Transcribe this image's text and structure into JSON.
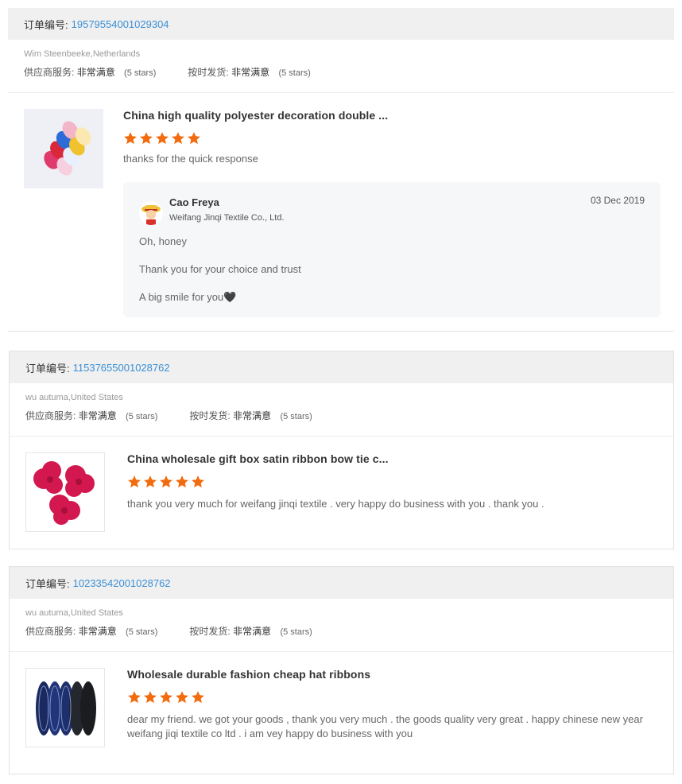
{
  "labels": {
    "order_no": "订单编号:",
    "supplier_service": "供应商服务:",
    "on_time_delivery": "按时发货:"
  },
  "reviews": [
    {
      "order_number": "19579554001029304",
      "buyer": "Wim Steenbeeke,Netherlands",
      "supplier_service": {
        "value": "非常满意",
        "stars_text": "(5 stars)"
      },
      "on_time_delivery": {
        "value": "非常满意",
        "stars_text": "(5 stars)"
      },
      "product_title": "China high quality polyester decoration double ...",
      "rating": 5,
      "comment": "thanks for the quick response",
      "reply": {
        "seller_name": "Cao Freya",
        "company": "Weifang Jinqi Textile Co., Ltd.",
        "date": "03 Dec 2019",
        "lines": [
          "Oh, honey",
          "Thank you for your choice and trust",
          "A big smile for you🖤"
        ]
      }
    },
    {
      "order_number": "11537655001028762",
      "buyer": "wu autuma,United States",
      "supplier_service": {
        "value": "非常满意",
        "stars_text": "(5 stars)"
      },
      "on_time_delivery": {
        "value": "非常满意",
        "stars_text": "(5 stars)"
      },
      "product_title": "China wholesale gift box satin ribbon bow tie c...",
      "rating": 5,
      "comment": "thank you very much for weifang jinqi textile . very happy do business with you . thank you ."
    },
    {
      "order_number": "10233542001028762",
      "buyer": "wu autuma,United States",
      "supplier_service": {
        "value": "非常满意",
        "stars_text": "(5 stars)"
      },
      "on_time_delivery": {
        "value": "非常满意",
        "stars_text": "(5 stars)"
      },
      "product_title": "Wholesale durable fashion cheap hat ribbons",
      "rating": 5,
      "comment": "dear my friend. we got your goods , thank you very much . the goods quality very great . happy chinese new year weifang jiqi textile co ltd . i am vey happy do business with you"
    }
  ],
  "colors": {
    "star": "#f26b0f",
    "order_link": "#3b8fd4",
    "order_bar": "#f0f0f0",
    "reply_bg": "#f6f7f9"
  }
}
